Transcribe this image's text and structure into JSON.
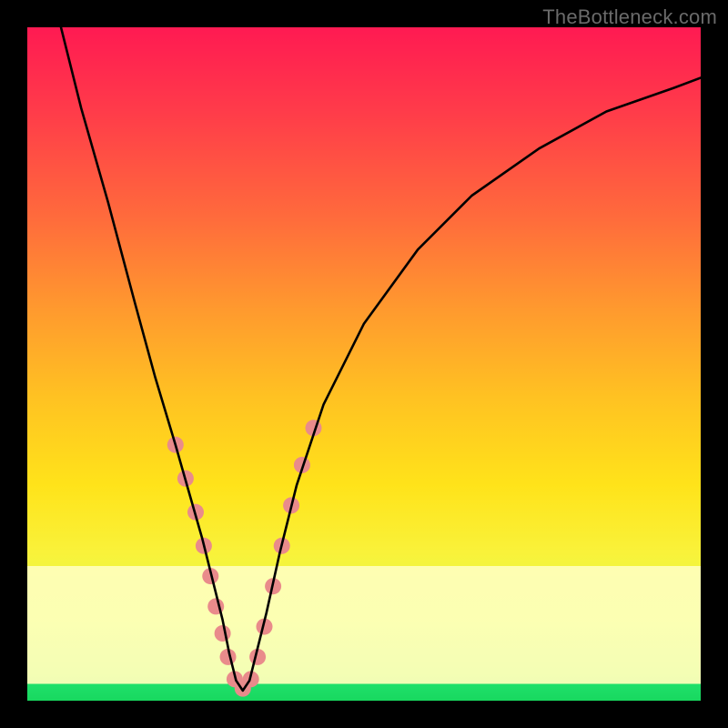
{
  "watermark": "TheBottleneck.com",
  "chart_data": {
    "type": "line",
    "title": "",
    "xlabel": "",
    "ylabel": "",
    "xlim": [
      0,
      100
    ],
    "ylim": [
      0,
      100
    ],
    "grid": false,
    "legend": false,
    "annotations": [],
    "curve": {
      "name": "bottleneck-curve",
      "color": "#000000",
      "x": [
        5,
        8,
        12,
        16,
        19,
        22,
        24,
        26,
        27.5,
        29,
        30,
        31,
        32,
        33,
        34,
        35.5,
        37.5,
        40,
        44,
        50,
        58,
        66,
        76,
        86,
        96,
        100
      ],
      "y": [
        100,
        88,
        74,
        59,
        48,
        38,
        31,
        24,
        18,
        12,
        7,
        3,
        1.5,
        3,
        7,
        13,
        22,
        32,
        44,
        56,
        67,
        75,
        82,
        87.5,
        91,
        92.5
      ]
    },
    "markers": {
      "name": "highlighted-points",
      "color": "#e98b8b",
      "radius": 9,
      "points": [
        {
          "x": 22.0,
          "y": 38.0
        },
        {
          "x": 23.5,
          "y": 33.0
        },
        {
          "x": 25.0,
          "y": 28.0
        },
        {
          "x": 26.2,
          "y": 23.0
        },
        {
          "x": 27.2,
          "y": 18.5
        },
        {
          "x": 28.0,
          "y": 14.0
        },
        {
          "x": 29.0,
          "y": 10.0
        },
        {
          "x": 29.8,
          "y": 6.5
        },
        {
          "x": 30.8,
          "y": 3.2
        },
        {
          "x": 32.0,
          "y": 1.8
        },
        {
          "x": 33.2,
          "y": 3.2
        },
        {
          "x": 34.2,
          "y": 6.5
        },
        {
          "x": 35.2,
          "y": 11.0
        },
        {
          "x": 36.5,
          "y": 17.0
        },
        {
          "x": 37.8,
          "y": 23.0
        },
        {
          "x": 39.2,
          "y": 29.0
        },
        {
          "x": 40.8,
          "y": 35.0
        },
        {
          "x": 42.5,
          "y": 40.5
        }
      ]
    }
  }
}
